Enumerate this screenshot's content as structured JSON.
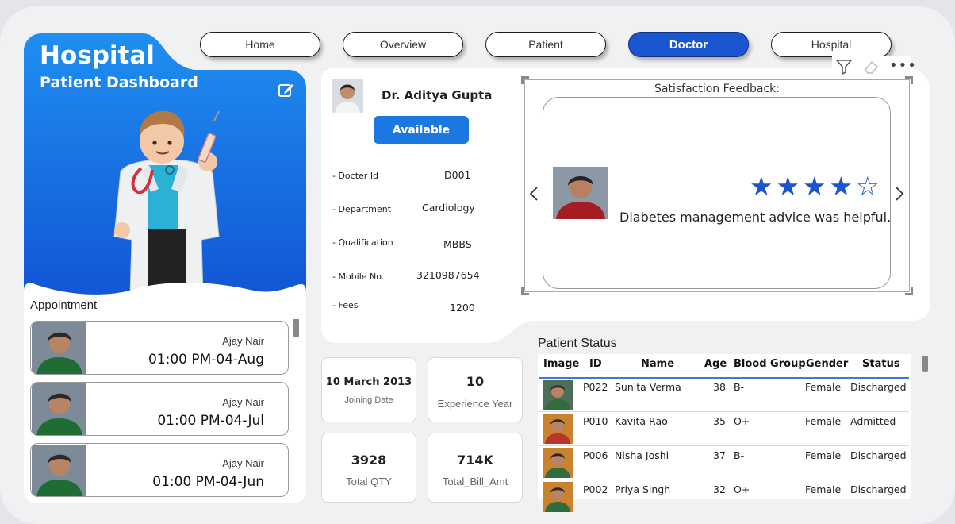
{
  "nav": [
    {
      "label": "Home",
      "active": false
    },
    {
      "label": "Overview",
      "active": false
    },
    {
      "label": "Patient",
      "active": false
    },
    {
      "label": "Doctor",
      "active": true
    },
    {
      "label": "Hospital",
      "active": false
    }
  ],
  "hero": {
    "title": "Hospital",
    "subtitle": "Patient Dashboard"
  },
  "appointment": {
    "title": "Appointment",
    "items": [
      {
        "name": "Ajay Nair",
        "time": "01:00 PM-04-Aug"
      },
      {
        "name": "Ajay Nair",
        "time": "01:00 PM-04-Jul"
      },
      {
        "name": "Ajay Nair",
        "time": "01:00 PM-04-Jun"
      }
    ]
  },
  "doctor": {
    "name": "Dr. Aditya Gupta",
    "status": "Available",
    "fields": [
      {
        "label": "- Docter Id",
        "value": "D001"
      },
      {
        "label": "- Department",
        "value": "Cardiology"
      },
      {
        "label": "- Qualification",
        "value": "MBBS"
      },
      {
        "label": "- Mobile No.",
        "value": "3210987654"
      },
      {
        "label": "- Fees",
        "value": "1200"
      }
    ]
  },
  "feedback": {
    "title": "Satisfaction Feedback:",
    "rating": 4,
    "max_rating": 5,
    "text": "Diabetes management advice was helpful."
  },
  "kpis": {
    "joining": {
      "value": "10 March 2013",
      "label": "Joining Date"
    },
    "experience": {
      "value": "10",
      "label": "Experience Year"
    },
    "qty": {
      "value": "3928",
      "label": "Total QTY"
    },
    "bill": {
      "value": "714K",
      "label": "Total_Bill_Amt"
    }
  },
  "patient_status": {
    "title": "Patient Status",
    "columns": [
      "Image",
      "ID",
      "Name",
      "Age",
      "Blood Group",
      "Gender",
      "Status"
    ],
    "rows": [
      {
        "id": "P022",
        "name": "Sunita Verma",
        "age": "38",
        "blood": "B-",
        "gender": "Female",
        "status": "Discharged"
      },
      {
        "id": "P010",
        "name": "Kavita Rao",
        "age": "35",
        "blood": "O+",
        "gender": "Female",
        "status": "Admitted"
      },
      {
        "id": "P006",
        "name": "Nisha Joshi",
        "age": "37",
        "blood": "B-",
        "gender": "Female",
        "status": "Discharged"
      },
      {
        "id": "P002",
        "name": "Priya Singh",
        "age": "32",
        "blood": "O+",
        "gender": "Female",
        "status": "Discharged"
      }
    ]
  },
  "colors": {
    "accent": "#1a56cf",
    "hero_top": "#1e8ff0",
    "hero_bottom": "#1355d6"
  },
  "icons": [
    "edit-icon",
    "filter-icon",
    "eraser-icon",
    "more-options-icon",
    "chevron-left-icon",
    "chevron-right-icon",
    "star-icon"
  ]
}
